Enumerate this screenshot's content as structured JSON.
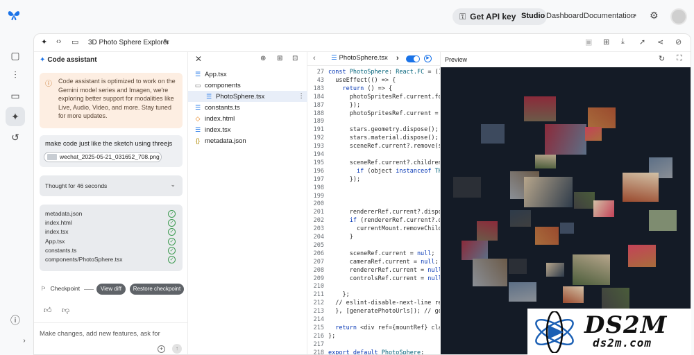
{
  "header": {
    "api_key_label": "Get API key",
    "links": [
      "Studio",
      "Dashboard",
      "Documentation"
    ]
  },
  "toolbar": {
    "project_title": "3D Photo Sphere Explorer"
  },
  "assistant": {
    "title": "Code assistant",
    "notice": "Code assistant is optimized to work on the Gemini model series and Imagen, we're exploring better support for modalities like Live, Audio, Video, and more. Stay tuned for more updates.",
    "prompt_text": "make code just like the sketch using threejs",
    "attachment_name": "wechat_2025-05-21_031652_708.png",
    "thought_label": "Thought for 46 seconds",
    "generated_files": [
      "metadata.json",
      "index.html",
      "index.tsx",
      "App.tsx",
      "constants.ts",
      "components/PhotoSphere.tsx"
    ],
    "checkpoint_label": "Checkpoint",
    "view_diff_label": "View diff",
    "restore_label": "Restore checkpoint",
    "input_placeholder": "Make changes, add new features, ask for"
  },
  "file_tree": [
    {
      "name": "App.tsx",
      "type": "tsx",
      "indent": 0,
      "selected": false
    },
    {
      "name": "components",
      "type": "folder",
      "indent": 0,
      "selected": false
    },
    {
      "name": "PhotoSphere.tsx",
      "type": "tsx",
      "indent": 1,
      "selected": true
    },
    {
      "name": "constants.ts",
      "type": "tsx",
      "indent": 0,
      "selected": false
    },
    {
      "name": "index.html",
      "type": "html",
      "indent": 0,
      "selected": false
    },
    {
      "name": "index.tsx",
      "type": "tsx",
      "indent": 0,
      "selected": false
    },
    {
      "name": "metadata.json",
      "type": "json",
      "indent": 0,
      "selected": false
    }
  ],
  "editor": {
    "active_tab": "PhotoSphere.tsx",
    "lines": [
      {
        "n": "27",
        "t": "const PhotoSphere: React.FC = () =>"
      },
      {
        "n": "43",
        "t": "  useEffect(() => {"
      },
      {
        "n": "183",
        "t": "    return () => {"
      },
      {
        "n": "184",
        "t": "      photoSpritesRef.current.for"
      },
      {
        "n": "187",
        "t": "      });"
      },
      {
        "n": "188",
        "t": "      photoSpritesRef.current = [];"
      },
      {
        "n": "189",
        "t": ""
      },
      {
        "n": "191",
        "t": "      stars.geometry.dispose();"
      },
      {
        "n": "192",
        "t": "      stars.material.dispose();"
      },
      {
        "n": "193",
        "t": "      sceneRef.current?.remove(star"
      },
      {
        "n": "194",
        "t": ""
      },
      {
        "n": "195",
        "t": "      sceneRef.current?.children.fo"
      },
      {
        "n": "196",
        "t": "        if (object instanceof THRE"
      },
      {
        "n": "197",
        "t": "      });"
      },
      {
        "n": "198",
        "t": ""
      },
      {
        "n": "199",
        "t": ""
      },
      {
        "n": "200",
        "t": ""
      },
      {
        "n": "201",
        "t": "      rendererRef.current?.dispose("
      },
      {
        "n": "202",
        "t": "      if (rendererRef.current?.domE"
      },
      {
        "n": "203",
        "t": "        currentMount.removeChild(r"
      },
      {
        "n": "204",
        "t": "      }"
      },
      {
        "n": "205",
        "t": ""
      },
      {
        "n": "206",
        "t": "      sceneRef.current = null;"
      },
      {
        "n": "207",
        "t": "      cameraRef.current = null;"
      },
      {
        "n": "208",
        "t": "      rendererRef.current = null;"
      },
      {
        "n": "209",
        "t": "      controlsRef.current = null;"
      },
      {
        "n": "210",
        "t": ""
      },
      {
        "n": "211",
        "t": "    };"
      },
      {
        "n": "212",
        "t": "  // eslint-disable-next-line react"
      },
      {
        "n": "213",
        "t": "  }, [generatePhotoUrls]); // gener"
      },
      {
        "n": "214",
        "t": ""
      },
      {
        "n": "215",
        "t": "  return <div ref={mountRef} classN"
      },
      {
        "n": "216",
        "t": "};"
      },
      {
        "n": "217",
        "t": ""
      },
      {
        "n": "218",
        "t": "export default PhotoSphere;"
      }
    ]
  },
  "preview": {
    "title": "Preview",
    "photo_colors": [
      "#6b5a48",
      "#a86d3c",
      "#3d4a5e",
      "#8b2a3a",
      "#c44258",
      "#4a5c3a",
      "#8a8f96",
      "#2b2f36",
      "#b7a68c",
      "#5c6f86",
      "#9a4a2e",
      "#3f3f3f",
      "#7e8c70",
      "#d2c1a6",
      "#2e3b4a"
    ]
  },
  "watermark": {
    "text": "DS2M",
    "sub": "ds2m.com"
  }
}
